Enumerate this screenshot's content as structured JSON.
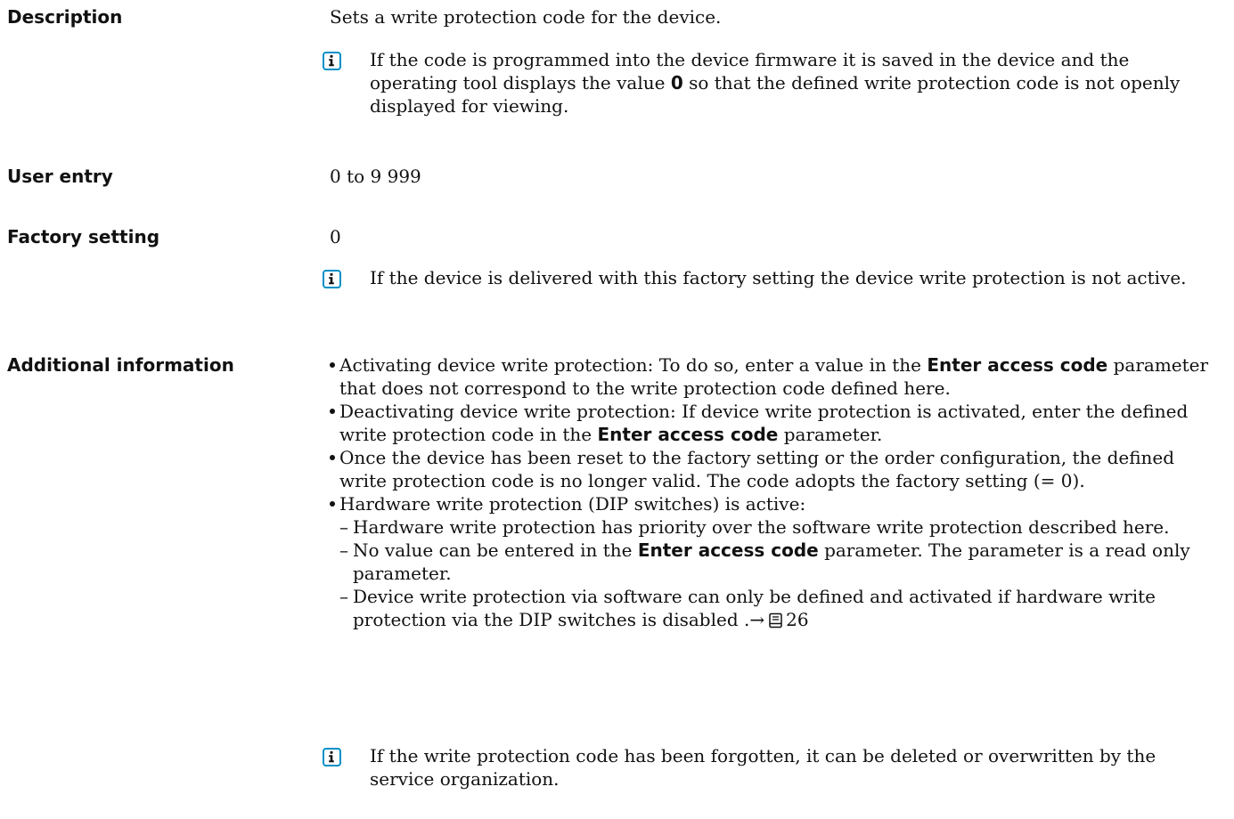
{
  "rows": {
    "description": {
      "label": "Description",
      "text": "Sets a write protection code for the device.",
      "note": {
        "icon": "info-icon",
        "part1": "If the code is programmed into the device firmware it is saved in the device and the operating tool displays the value ",
        "bold": "0",
        "part2": " so that the defined write protection code is not openly displayed for viewing."
      }
    },
    "user_entry": {
      "label": "User entry",
      "value": "0 to 9 999"
    },
    "factory_setting": {
      "label": "Factory setting",
      "value": "0",
      "note": {
        "icon": "info-icon",
        "text": "If the device is delivered with this factory setting the device write protection is not active."
      }
    },
    "additional_information": {
      "label": "Additional information",
      "bullets": [
        {
          "a": "Activating device write protection: To do so, enter a value in the ",
          "bold": "Enter access code",
          "b": " parameter that does not correspond to the write protection code defined here."
        },
        {
          "a": "Deactivating device write protection: If device write protection is activated, enter the defined write protection code in the ",
          "bold": "Enter access code",
          "b": " parameter."
        },
        {
          "text": "Once the device has been reset to the factory setting or the order configuration, the defined write protection code is no longer valid. The code adopts the factory setting (= 0)."
        },
        {
          "text": "Hardware write protection (DIP switches) is active:",
          "sub": [
            {
              "text": "Hardware write protection has priority over the software write protection described here."
            },
            {
              "a": "No value can be entered in the ",
              "bold": "Enter access code",
              "b": " parameter. The parameter is a read only parameter."
            },
            {
              "text": "Device write protection via software can only be defined and activated if hardware write protection via the DIP switches is disabled .",
              "arrow": "→",
              "page_icon": "book-icon",
              "page": "26"
            }
          ]
        }
      ],
      "note": {
        "icon": "info-icon",
        "text": "If the write protection code has been forgotten, it can be deleted or overwritten by the service organization."
      }
    }
  }
}
